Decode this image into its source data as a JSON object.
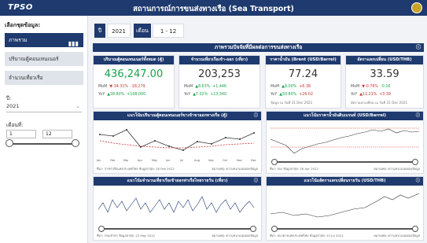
{
  "header": {
    "logo_text": "TPSO",
    "title": "สถานการณ์การขนส่งทางเรือ (Sea Transport)"
  },
  "sidebar": {
    "heading": "เลือกชุดข้อมูล:",
    "items": [
      {
        "label": "ภาพรวม"
      },
      {
        "label": "ปริมาณตู้คอนเทนเนอร์"
      },
      {
        "label": "จำนวนเที่ยวเรือ"
      }
    ],
    "year_label": "ปี:",
    "year_value": "2021",
    "month_label": "เดือนที่:",
    "month_from": "1",
    "month_to": "12"
  },
  "filters": {
    "year_tag": "ปี",
    "year": "2021",
    "month_tag": "เดือน",
    "months": "1 - 12"
  },
  "section_title": "ภาพรวมปัจจัยที่มีผลต่อการขนส่งทางเรือ",
  "kpis": [
    {
      "title": "ปริมาณตู้คอนเทนเนอร์ทั้งหมด (ตู้)",
      "value": "436,247.00",
      "r1_label": "MoM",
      "r1_pct": "▼-34.31%",
      "r1_abs": "-18,279",
      "r2_label": "YoY",
      "r2_pct": "▲38.80%",
      "r2_abs": "+108,000"
    },
    {
      "title": "จำนวนเที่ยวเรือเข้า-ออก (เที่ยว)",
      "value": "203,253",
      "r1_label": "MoM",
      "r1_pct": "▲8.63%",
      "r1_abs": "+1,446",
      "r2_label": "YoY",
      "r2_pct": "▲7.02%",
      "r2_abs": "+13,340"
    },
    {
      "title": "ราคาน้ำมัน (Brent (USD/Barrel)",
      "value": "77.24",
      "r1_label": "MoM",
      "r1_pct": "▲8.00%",
      "r1_abs": "+6.38",
      "r2_label": "YoY",
      "r2_pct": "▲50.80%",
      "r2_abs": "+26.02",
      "foot": "ข้อมูล ณ วันที่ 31 Dec 2021"
    },
    {
      "title": "อัตราแลกเปลี่ยน (USD/THB)",
      "value": "33.59",
      "r1_label": "MoM",
      "r1_pct": "▼-0.76%",
      "r1_abs": "-0.16",
      "r2_label": "YoY",
      "r2_pct": "▲11.21%",
      "r2_abs": "+3.39",
      "foot": "อัตราแลกเปลี่ยน ณ วันที่ 31 Dec 2021"
    }
  ],
  "charts": {
    "c1": {
      "title": "แนวโน้มปริมาณตู้คอนเทนเนอร์ขาเข้าขาออกทางเรือ (ตู้)",
      "xlabels": [
        "Jan",
        "Feb",
        "Mar",
        "Apr",
        "May",
        "Jun",
        "Jul",
        "Aug",
        "Sep",
        "Oct",
        "Nov",
        "Dec"
      ],
      "foot_left": "ที่มา: การท่าเรือแห่งประเทศไทย  ข้อมูลล่าสุด: 28 Feb 2022",
      "foot_right": "หมายเหตุ: ความหนาแน่นของข้อมูล"
    },
    "c2": {
      "title": "แนวโน้มราคาน้ำมันดิบเบรนท์ (USD/Barrel)",
      "foot_left": "ที่มา: EIA  ข้อมูลล่าสุด: 28 Apr 2022",
      "foot_right": "หมายเหตุ: ความหนาแน่นของข้อมูล"
    },
    "c3": {
      "title": "แนวโน้มจำนวนเที่ยวเรือเข้าออกท่าเรือไทยรายวัน (เที่ยว)",
      "foot_left": "ที่มา: กรมเจ้าท่า  ข้อมูลล่าสุด: 23 May 2022",
      "foot_right": "หมายเหตุ: ความหนาแน่นของข้อมูล"
    },
    "c4": {
      "title": "แนวโน้มอัตราแลกเปลี่ยนรายวัน (USD/THB)",
      "foot_left": "ที่มา: ธนาคารแห่งประเทศไทย  ข้อมูลล่าสุด: 22 Jul 2022",
      "foot_right": "หมายเหตุ: ความหนาแน่นของข้อมูล"
    }
  },
  "colors": {
    "navy": "#1e3a6e",
    "green": "#17a34a",
    "red": "#d0312d"
  }
}
